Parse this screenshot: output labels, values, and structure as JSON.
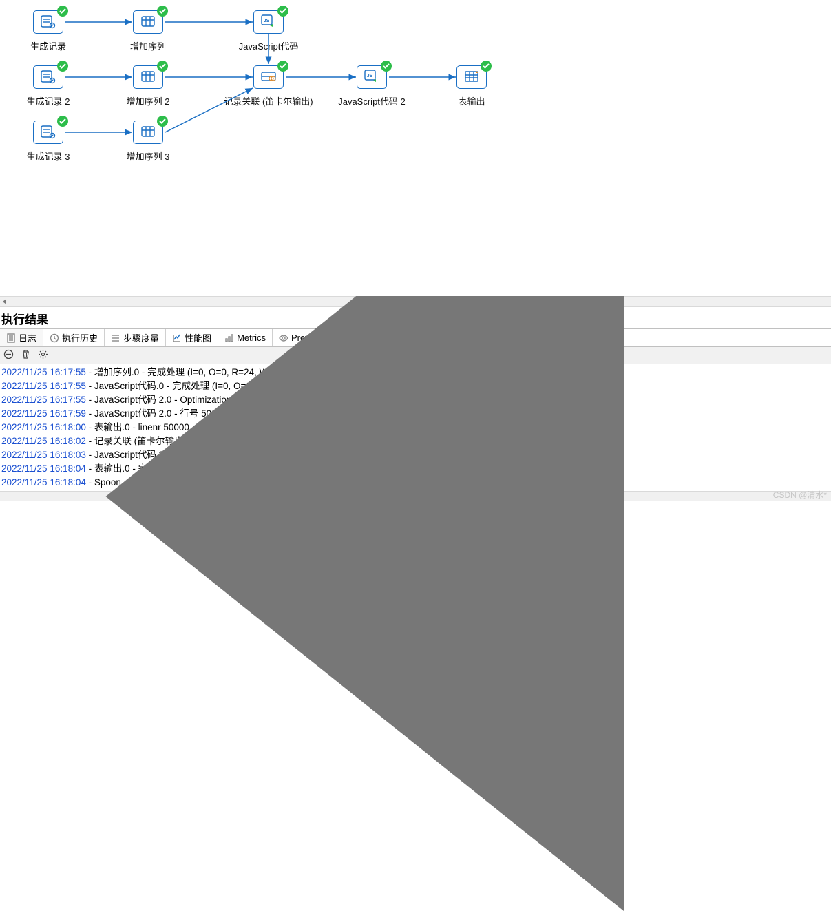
{
  "nodes": {
    "n0": {
      "label": "生成记录",
      "icon": "generate"
    },
    "n1": {
      "label": "增加序列",
      "icon": "sequence"
    },
    "n2": {
      "label": "JavaScript代码",
      "icon": "js"
    },
    "n3": {
      "label": "生成记录 2",
      "icon": "generate"
    },
    "n4": {
      "label": "增加序列 2",
      "icon": "sequence"
    },
    "n5": {
      "label": "记录关联 (笛卡尔输出)",
      "icon": "join"
    },
    "n6": {
      "label": "JavaScript代码 2",
      "icon": "js"
    },
    "n7": {
      "label": "表输出",
      "icon": "table"
    },
    "n8": {
      "label": "生成记录 3",
      "icon": "generate"
    },
    "n9": {
      "label": "增加序列 3",
      "icon": "sequence"
    }
  },
  "results_title": "执行结果",
  "tabs": {
    "t0": {
      "label": "日志",
      "icon": "doc"
    },
    "t1": {
      "label": "执行历史",
      "icon": "clock"
    },
    "t2": {
      "label": "步骤度量",
      "icon": "bars"
    },
    "t3": {
      "label": "性能图",
      "icon": "chart"
    },
    "t4": {
      "label": "Metrics",
      "icon": "metrics"
    },
    "t5": {
      "label": "Preview data",
      "icon": "eye"
    }
  },
  "log": [
    {
      "ts": "2022/11/25 16:17:55",
      "msg": " - 增加序列.0 - 完成处理 (I=0, O=0, R=24, W=24, U=0, E=0)"
    },
    {
      "ts": "2022/11/25 16:17:55",
      "msg": " - JavaScript代码.0 - 完成处理 (I=0, O=0, R=24, W=24, U=0, E=0)"
    },
    {
      "ts": "2022/11/25 16:17:55",
      "msg": " - JavaScript代码 2.0 - Optimization level set to 9."
    },
    {
      "ts": "2022/11/25 16:17:59",
      "msg": " - JavaScript代码 2.0 - 行号 50000"
    },
    {
      "ts": "2022/11/25 16:18:00",
      "msg": " - 表输出.0 - linenr 50000"
    },
    {
      "ts": "2022/11/25 16:18:02",
      "msg": " - 记录关联 (笛卡尔输出).0 - 完成处理 (I=0, O=0, R=144, W=86400, U=0, E=0)"
    },
    {
      "ts": "2022/11/25 16:18:03",
      "msg": " - JavaScript代码 2.0 - 完成处理 (I=0, O=0, R=86400, W=86400, U=0, E=0)"
    },
    {
      "ts": "2022/11/25 16:18:04",
      "msg": " - 表输出.0 - 完成处理 (I=0, O=86400, R=86400, W=86400, U=0, E=0)"
    },
    {
      "ts": "2022/11/25 16:18:04",
      "msg": " - Spoon - 转换完成!!"
    }
  ],
  "watermark": "CSDN @清水*"
}
